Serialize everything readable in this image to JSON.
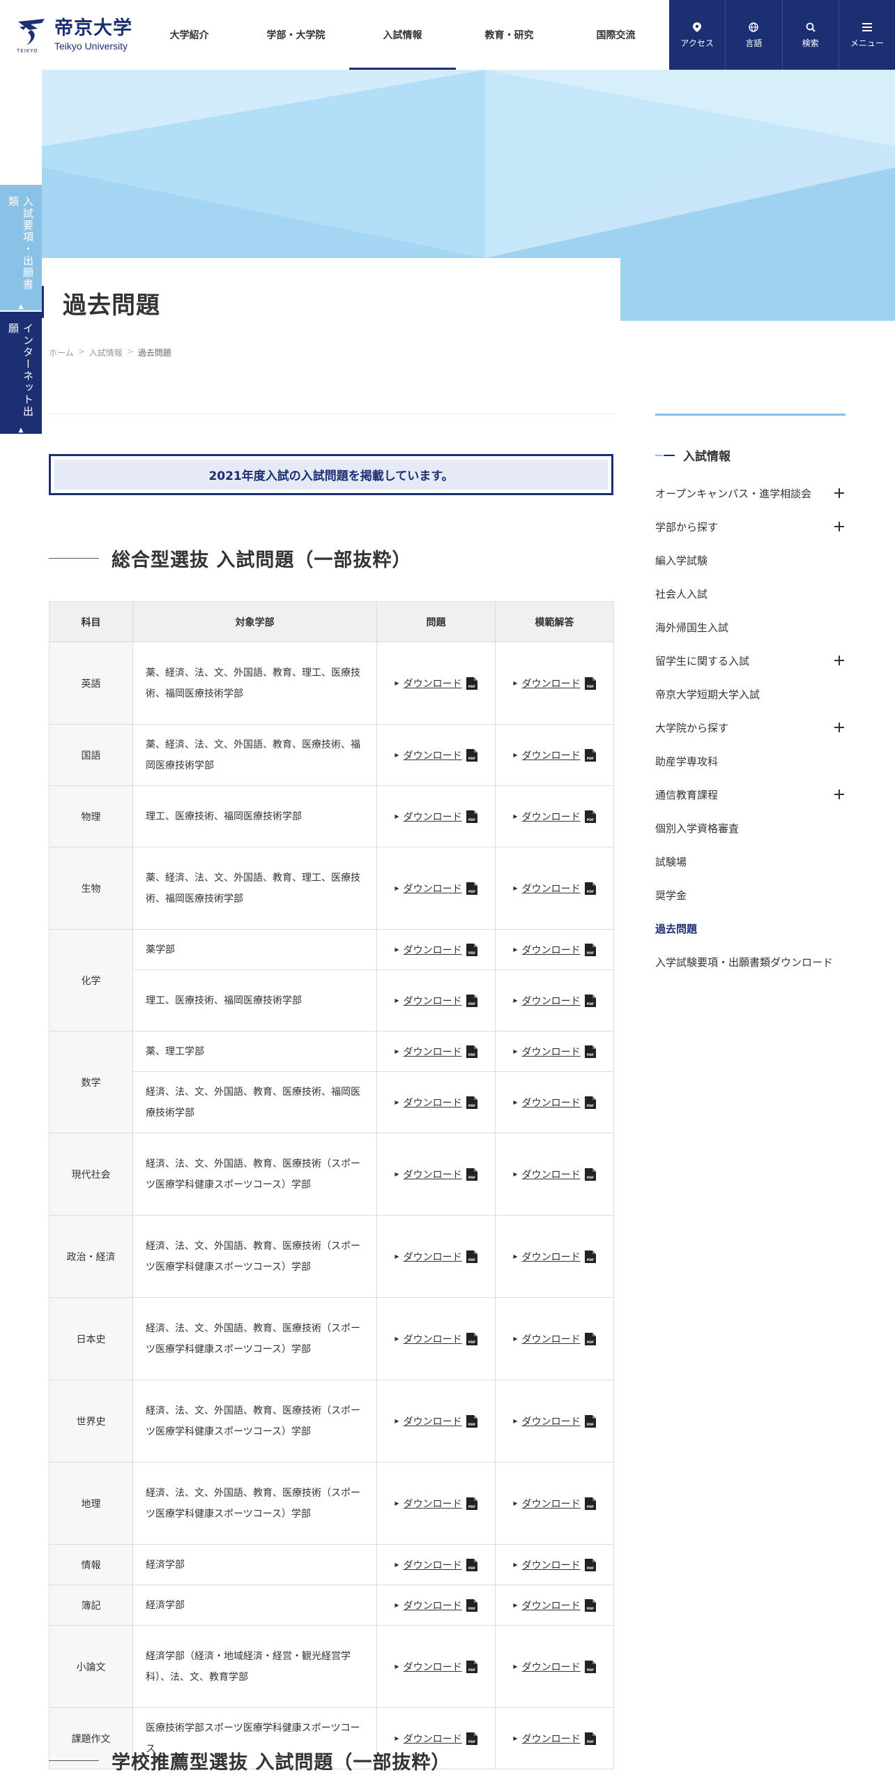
{
  "header": {
    "logo": {
      "jp": "帝京大学",
      "en": "Teikyo University",
      "mini": "TEIKYO"
    },
    "nav": [
      {
        "label": "大学紹介"
      },
      {
        "label": "学部・大学院"
      },
      {
        "label": "入試情報",
        "active": true
      },
      {
        "label": "教育・研究"
      },
      {
        "label": "国際交流"
      }
    ],
    "utility": [
      {
        "label": "アクセス",
        "icon": "map-pin-icon"
      },
      {
        "label": "言語",
        "icon": "globe-icon"
      },
      {
        "label": "検索",
        "icon": "search-icon"
      },
      {
        "label": "メニュー",
        "icon": "hamburger-menu-icon"
      }
    ]
  },
  "side_tabs": {
    "tab1": "入試要項・出願書類",
    "tab2": "インターネット出願",
    "arrow": "▲"
  },
  "page": {
    "title": "過去問題",
    "breadcrumb": [
      "ホーム",
      "入試情報",
      "過去問題"
    ],
    "breadcrumb_sep": ">",
    "notice": "2021年度入試の入試問題を掲載しています。",
    "section1_title": "総合型選抜 入試問題（一部抜粋）",
    "section2_title": "学校推薦型選抜 入試問題（一部抜粋）"
  },
  "table": {
    "headers": [
      "科目",
      "対象学部",
      "問題",
      "模範解答"
    ],
    "download_label": "ダウンロード",
    "pdf_label": "PDF",
    "rows": [
      {
        "subject": "英語",
        "faculty": "薬、経済、法、文、外国語、教育、理工、医療技術、福岡医療技術学部",
        "span": 1
      },
      {
        "subject": "国語",
        "faculty": "薬、経済、法、文、外国語、教育、医療技術、福岡医療技術学部",
        "span": 1
      },
      {
        "subject": "物理",
        "faculty": "理工、医療技術、福岡医療技術学部",
        "span": 1
      },
      {
        "subject": "生物",
        "faculty": "薬、経済、法、文、外国語、教育、理工、医療技術、福岡医療技術学部",
        "span": 1
      },
      {
        "subject": "化学",
        "faculty": "薬学部",
        "span": 2
      },
      {
        "subject": "",
        "faculty": "理工、医療技術、福岡医療技術学部",
        "span": 0
      },
      {
        "subject": "数学",
        "faculty": "薬、理工学部",
        "span": 2
      },
      {
        "subject": "",
        "faculty": "経済、法、文、外国語、教育、医療技術、福岡医療技術学部",
        "span": 0
      },
      {
        "subject": "現代社会",
        "faculty": "経済、法、文、外国語、教育、医療技術（スポーツ医療学科健康スポーツコース）学部",
        "span": 1
      },
      {
        "subject": "政治・経済",
        "faculty": "経済、法、文、外国語、教育、医療技術（スポーツ医療学科健康スポーツコース）学部",
        "span": 1
      },
      {
        "subject": "日本史",
        "faculty": "経済、法、文、外国語、教育、医療技術（スポーツ医療学科健康スポーツコース）学部",
        "span": 1
      },
      {
        "subject": "世界史",
        "faculty": "経済、法、文、外国語、教育、医療技術（スポーツ医療学科健康スポーツコース）学部",
        "span": 1
      },
      {
        "subject": "地理",
        "faculty": "経済、法、文、外国語、教育、医療技術（スポーツ医療学科健康スポーツコース）学部",
        "span": 1
      },
      {
        "subject": "情報",
        "faculty": "経済学部",
        "span": 1
      },
      {
        "subject": "簿記",
        "faculty": "経済学部",
        "span": 1
      },
      {
        "subject": "小論文",
        "faculty": "経済学部（経済・地域経済・経営・観光経営学科）、法、文、教育学部",
        "span": 1
      },
      {
        "subject": "課題作文",
        "faculty": "医療技術学部スポーツ医療学科健康スポーツコース",
        "span": 1
      }
    ]
  },
  "sidebar": {
    "heading": "入試情報",
    "items": [
      {
        "label": "オープンキャンパス・進学相談会",
        "expandable": true
      },
      {
        "label": "学部から探す",
        "expandable": true
      },
      {
        "label": "編入学試験"
      },
      {
        "label": "社会人入試"
      },
      {
        "label": "海外帰国生入試"
      },
      {
        "label": "留学生に関する入試",
        "expandable": true
      },
      {
        "label": "帝京大学短期大学入試"
      },
      {
        "label": "大学院から探す",
        "expandable": true
      },
      {
        "label": "助産学専攻科"
      },
      {
        "label": "通信教育課程",
        "expandable": true
      },
      {
        "label": "個別入学資格審査"
      },
      {
        "label": "試験場"
      },
      {
        "label": "奨学金"
      },
      {
        "label": "過去問題",
        "active": true
      },
      {
        "label": "入学試験要項・出願書類ダウンロード"
      }
    ]
  },
  "colors": {
    "brand_navy": "#1d2f73",
    "light_blue": "#8ac1e6",
    "notice_bg": "#e5eaf6"
  }
}
